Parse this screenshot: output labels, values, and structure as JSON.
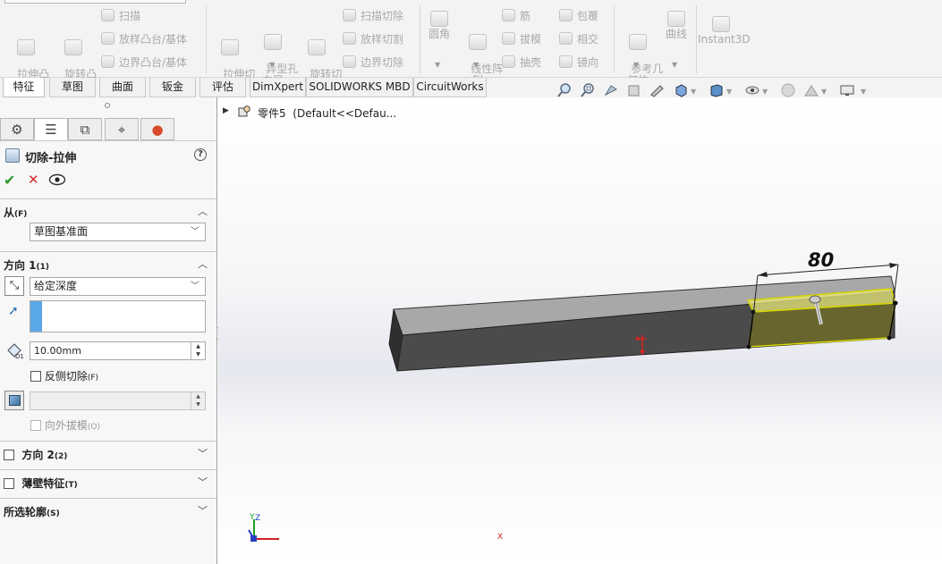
{
  "ribbon": {
    "extrude_boss": "拉伸凸\n台/基体",
    "revolve_boss": "旋转凸\n台/基体",
    "sweep": "扫描",
    "loft_boss": "放样凸台/基体",
    "boundary_boss": "边界凸台/基体",
    "extrude_cut": "拉伸切\n除",
    "hole_wizard": "异型孔\n向导",
    "revolve_cut": "旋转切\n除",
    "swept_cut": "扫描切除",
    "lofted_cut": "放样切割",
    "boundary_cut": "边界切除",
    "fillet": "圆角",
    "linear_pattern": "线性阵\n列",
    "rib": "筋",
    "draft": "拔模",
    "shell": "抽壳",
    "wrap": "包覆",
    "intersect": "相交",
    "mirror": "镜向",
    "ref_geometry": "参考几\n何体",
    "curves": "曲线",
    "instant3d": "Instant3D"
  },
  "tabs": [
    "特征",
    "草图",
    "曲面",
    "钣金",
    "评估",
    "DimXpert",
    "SOLIDWORKS MBD",
    "CircuitWorks"
  ],
  "tree": {
    "part_name": "零件5",
    "config": "(Default<<Defau..."
  },
  "panel": {
    "title": "切除-拉伸",
    "from_label": "从",
    "from_key": "(F)",
    "from_value": "草图基准面",
    "dir1_label": "方向 1",
    "dir1_key": "(1)",
    "end_condition": "给定深度",
    "depth": "10.00mm",
    "flip_cut": "反侧切除",
    "flip_cut_key": "(F)",
    "draft_outward": "向外拔模",
    "draft_outward_key": "(O)",
    "dir2_label": "方向 2",
    "dir2_key": "(2)",
    "thin_label": "薄壁特征",
    "thin_key": "(T)",
    "contours_label": "所选轮廓",
    "contours_key": "(S)"
  },
  "viewport": {
    "dimension": "80",
    "axis_x": "X",
    "axis_y": "Y",
    "axis_z": "Z"
  }
}
